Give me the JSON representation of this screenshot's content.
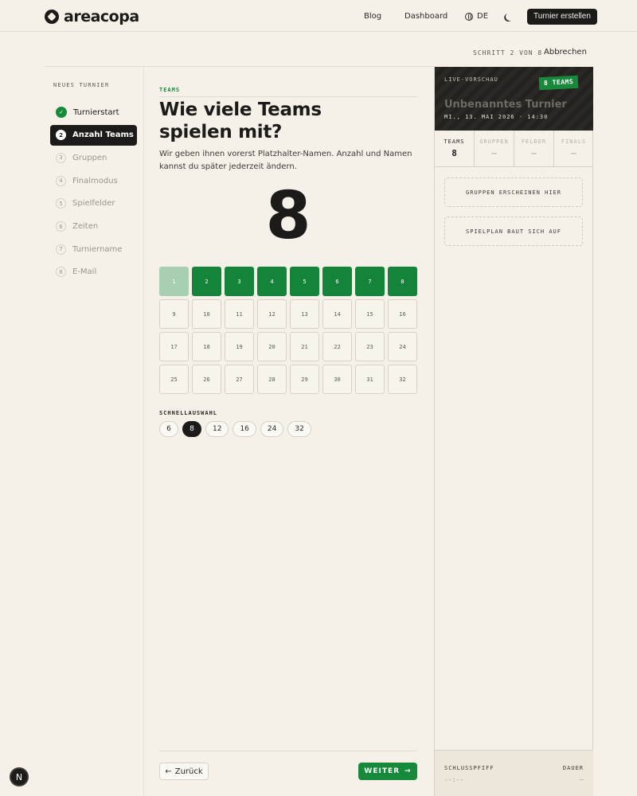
{
  "nav": {
    "logo": "areacopa",
    "links": [
      "Blog",
      "Dashboard"
    ],
    "language": "DE",
    "cta": "Turnier erstellen"
  },
  "progress": {
    "step_label": "SCHRITT 2 VON 8",
    "cancel": "Abbrechen"
  },
  "sidebar": {
    "title": "NEUES TURNIER",
    "steps": [
      {
        "num": "✓",
        "label": "Turnierstart",
        "state": "done"
      },
      {
        "num": "2",
        "label": "Anzahl Teams",
        "state": "active"
      },
      {
        "num": "3",
        "label": "Gruppen",
        "state": "todo"
      },
      {
        "num": "4",
        "label": "Finalmodus",
        "state": "todo"
      },
      {
        "num": "5",
        "label": "Spielfelder",
        "state": "todo"
      },
      {
        "num": "6",
        "label": "Zeiten",
        "state": "todo"
      },
      {
        "num": "7",
        "label": "Turniername",
        "state": "todo"
      },
      {
        "num": "8",
        "label": "E-Mail",
        "state": "todo"
      }
    ]
  },
  "main": {
    "kicker": "TEAMS",
    "headline_line1": "Wie viele Teams",
    "headline_line2": "spielen mit?",
    "description": "Wir geben ihnen vorerst Platzhalter-Namen. Anzahl und Namen kannst du später jederzeit ändern.",
    "count": "8",
    "selected_count": 8,
    "grid": [
      "1",
      "2",
      "3",
      "4",
      "5",
      "6",
      "7",
      "8",
      "9",
      "10",
      "11",
      "12",
      "13",
      "14",
      "15",
      "16",
      "17",
      "18",
      "19",
      "20",
      "21",
      "22",
      "23",
      "24",
      "25",
      "26",
      "27",
      "28",
      "29",
      "30",
      "31",
      "32"
    ],
    "quick_label": "SCHNELLAUSWAHL",
    "quick_options": [
      "6",
      "8",
      "12",
      "16",
      "24",
      "32"
    ],
    "quick_selected": "8",
    "back": "Zurück",
    "back_arrow": "←",
    "next": "WEITER",
    "next_arrow": "→"
  },
  "preview": {
    "kicker": "LIVE-VORSCHAU",
    "badge": "8 TEAMS",
    "title": "Unbenanntes Turnier",
    "date": "MI., 13. MAI 2026 · 14:30",
    "stats": [
      {
        "label": "TEAMS",
        "value": "8"
      },
      {
        "label": "GRUPPEN",
        "value": "—"
      },
      {
        "label": "FELDER",
        "value": "—"
      },
      {
        "label": "FINALS",
        "value": "—"
      }
    ],
    "placeholder_groups": "GRUPPEN ERSCHEINEN HIER",
    "placeholder_schedule": "SPIELPLAN BAUT SICH AUF",
    "footer_left_label": "SCHLUSSPFIFF",
    "footer_left_value": "--:--",
    "footer_right_label": "DAUER",
    "footer_right_value": "—"
  },
  "badge": "N",
  "colors": {
    "accent_green": "#168a3a",
    "dark": "#1c1b19",
    "background": "#f5f1e8"
  }
}
